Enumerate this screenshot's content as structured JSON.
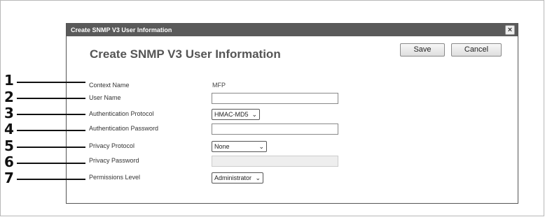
{
  "window": {
    "title": "Create SNMP V3 User Information",
    "close_symbol": "×"
  },
  "page": {
    "title": "Create SNMP V3 User Information"
  },
  "buttons": {
    "save_label": "Save",
    "cancel_label": "Cancel"
  },
  "form": {
    "context_name": {
      "label": "Context Name",
      "value": "MFP"
    },
    "user_name": {
      "label": "User Name",
      "value": ""
    },
    "auth_protocol": {
      "label": "Authentication Protocol",
      "selected": "HMAC-MD5"
    },
    "auth_password": {
      "label": "Authentication Password",
      "value": ""
    },
    "privacy_protocol": {
      "label": "Privacy Protocol",
      "selected": "None"
    },
    "privacy_password": {
      "label": "Privacy Password",
      "value": "",
      "disabled": true
    },
    "permissions_level": {
      "label": "Permissions Level",
      "selected": "Administrator"
    }
  },
  "callouts": [
    "1",
    "2",
    "3",
    "4",
    "5",
    "6",
    "7"
  ],
  "icons": {
    "close": "close-icon",
    "dropdown": "chevron-down-icon"
  }
}
